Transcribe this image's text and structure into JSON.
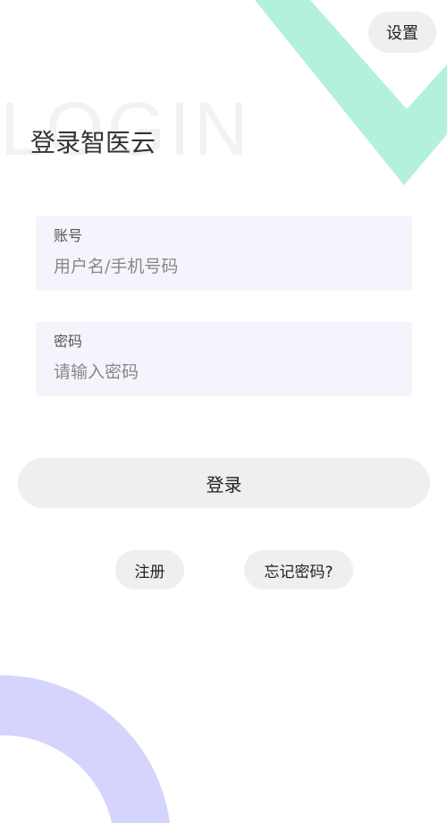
{
  "header": {
    "settings_label": "设置",
    "watermark": "LOGIN",
    "title": "登录智医云"
  },
  "form": {
    "account": {
      "label": "账号",
      "value": "",
      "placeholder": "用户名/手机号码"
    },
    "password": {
      "label": "密码",
      "value": "",
      "placeholder": "请输入密码"
    }
  },
  "actions": {
    "login_label": "登录",
    "register_label": "注册",
    "forgot_label": "忘记密码?"
  },
  "colors": {
    "accent_mint": "#b3f0dd",
    "accent_lavender": "#d4d4fc",
    "field_background": "#f5f4fc",
    "button_background": "#efefef"
  }
}
